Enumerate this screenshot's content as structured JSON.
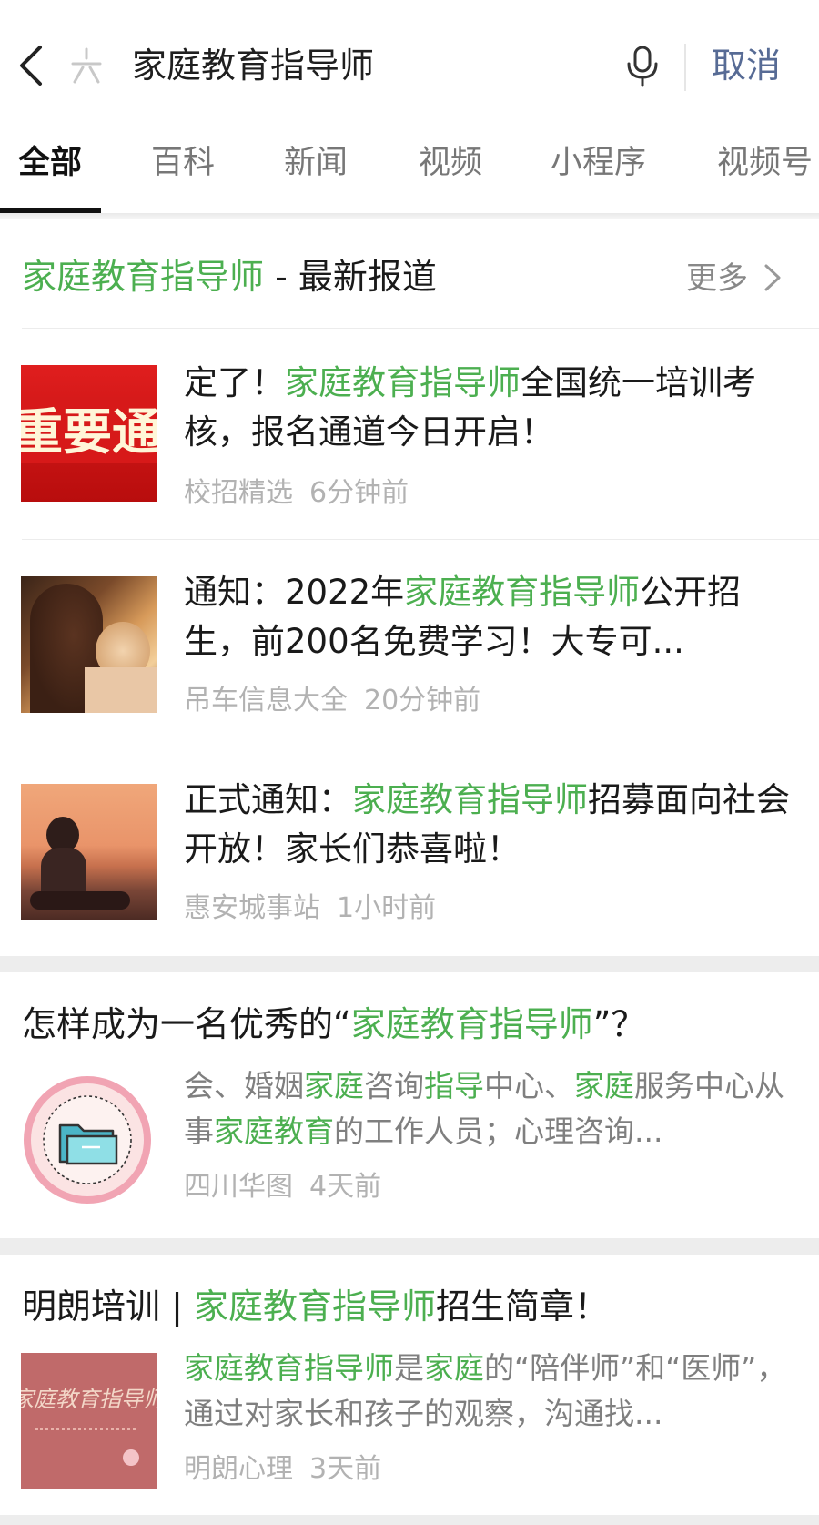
{
  "search": {
    "query": "家庭教育指导师",
    "cancel_label": "取消"
  },
  "tabs": [
    {
      "label": "全部"
    },
    {
      "label": "百科"
    },
    {
      "label": "新闻"
    },
    {
      "label": "视频"
    },
    {
      "label": "小程序"
    },
    {
      "label": "视频号"
    }
  ],
  "news": {
    "title_keyword": "家庭教育指导师",
    "title_rest": " - 最新报道",
    "more_label": "更多",
    "items": [
      {
        "title_pre": "定了！",
        "title_kw": "家庭教育指导师",
        "title_post": "全国统一培训考核，报名通道今日开启！",
        "source": "校招精选",
        "time": "6分钟前",
        "thumb_text": "重要通知"
      },
      {
        "title_pre": "通知：2022年",
        "title_kw": "家庭教育指导师",
        "title_post": "公开招生，前200名免费学习！大专可...",
        "source": "吊车信息大全",
        "time": "20分钟前"
      },
      {
        "title_pre": "正式通知：",
        "title_kw": "家庭教育指导师",
        "title_post": "招募面向社会开放！家长们恭喜啦！",
        "source": "惠安城事站",
        "time": "1小时前"
      }
    ]
  },
  "cards": [
    {
      "title_pre": "怎样成为一名优秀的“",
      "title_kw": "家庭教育指导师",
      "title_post": "”？",
      "snippet": [
        "会、婚姻",
        "家庭",
        "咨询",
        "指导",
        "中心、",
        "家庭",
        "服务中心从事",
        "家庭教育",
        "的工作人员；心理咨询..."
      ],
      "source": "四川华图",
      "time": "4天前"
    },
    {
      "title_pre": "明朗培训 | ",
      "title_kw": "家庭教育指导师",
      "title_post": "招生简章！",
      "snippet": [
        "家庭教育指导师",
        "是",
        "家庭",
        "的“陪伴师”和“医师”，通过对家长和孩子的观察，沟通找..."
      ],
      "source": "明朗心理",
      "time": "3天前",
      "thumb_text": "家庭教育指导师"
    }
  ],
  "colors": {
    "highlight": "#4caf50",
    "link": "#576b95",
    "meta": "#b2b2b2"
  }
}
